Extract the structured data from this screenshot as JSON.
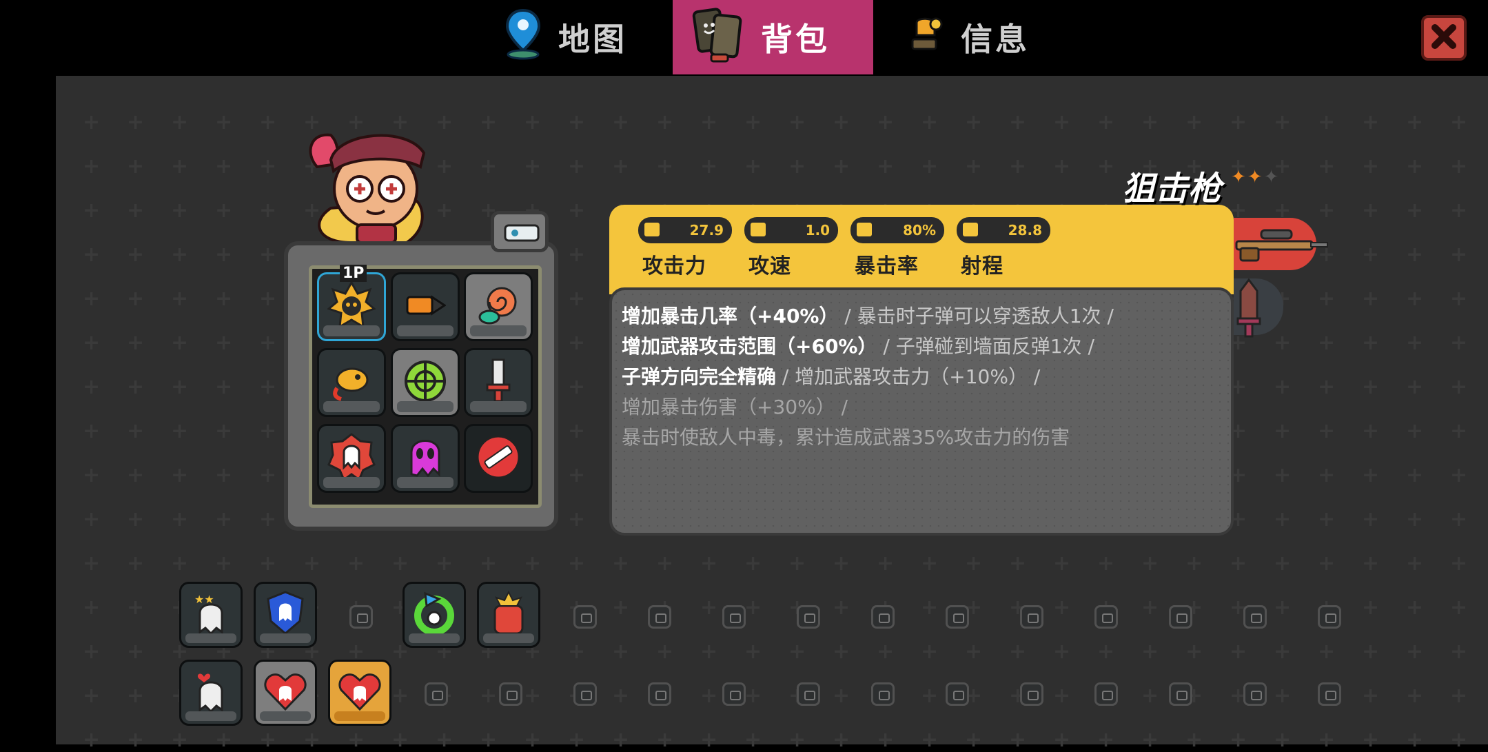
{
  "tabs": [
    {
      "label": "地图",
      "icon": "map-pin-icon",
      "active": false
    },
    {
      "label": "背包",
      "icon": "backpack-icon",
      "active": true
    },
    {
      "label": "信息",
      "icon": "info-trophy-icon",
      "active": false
    }
  ],
  "colors": {
    "accent": "#b8336d",
    "yellow": "#f4c53c",
    "close": "#c8463e"
  },
  "weapon": {
    "name": "狙击枪",
    "stars": "✦✦✦",
    "stats": [
      {
        "value": "27.9",
        "label": "攻击力",
        "icon": "bullet-icon"
      },
      {
        "value": "1.0",
        "label": "攻速",
        "icon": "fast-bullet-icon"
      },
      {
        "value": "80%",
        "label": "暴击率",
        "icon": "crit-icon"
      },
      {
        "value": "28.8",
        "label": "射程",
        "icon": "scope-icon"
      }
    ],
    "effects": [
      {
        "text": "增加暴击几率（+40%）",
        "sep": " / ",
        "text2": "暴击时子弹可以穿透敌人1次",
        "sep2": " /"
      },
      {
        "text": "增加武器攻击范围（+60%）",
        "sep": " / ",
        "text2": "子弹碰到墙面反弹1次",
        "sep2": " /"
      },
      {
        "text": "子弹方向完全精确",
        "sep": " / ",
        "text2": "增加武器攻击力（+10%）",
        "sep2": " /"
      },
      {
        "text": "增加暴击伤害（+30%）",
        "sep": " /",
        "text2": "",
        "sep2": ""
      },
      {
        "text": "暴击时使敌人中毒，累计造成武器35%攻击力的伤害",
        "sep": "",
        "text2": "",
        "sep2": ""
      }
    ]
  },
  "inventory_badge": "1P"
}
